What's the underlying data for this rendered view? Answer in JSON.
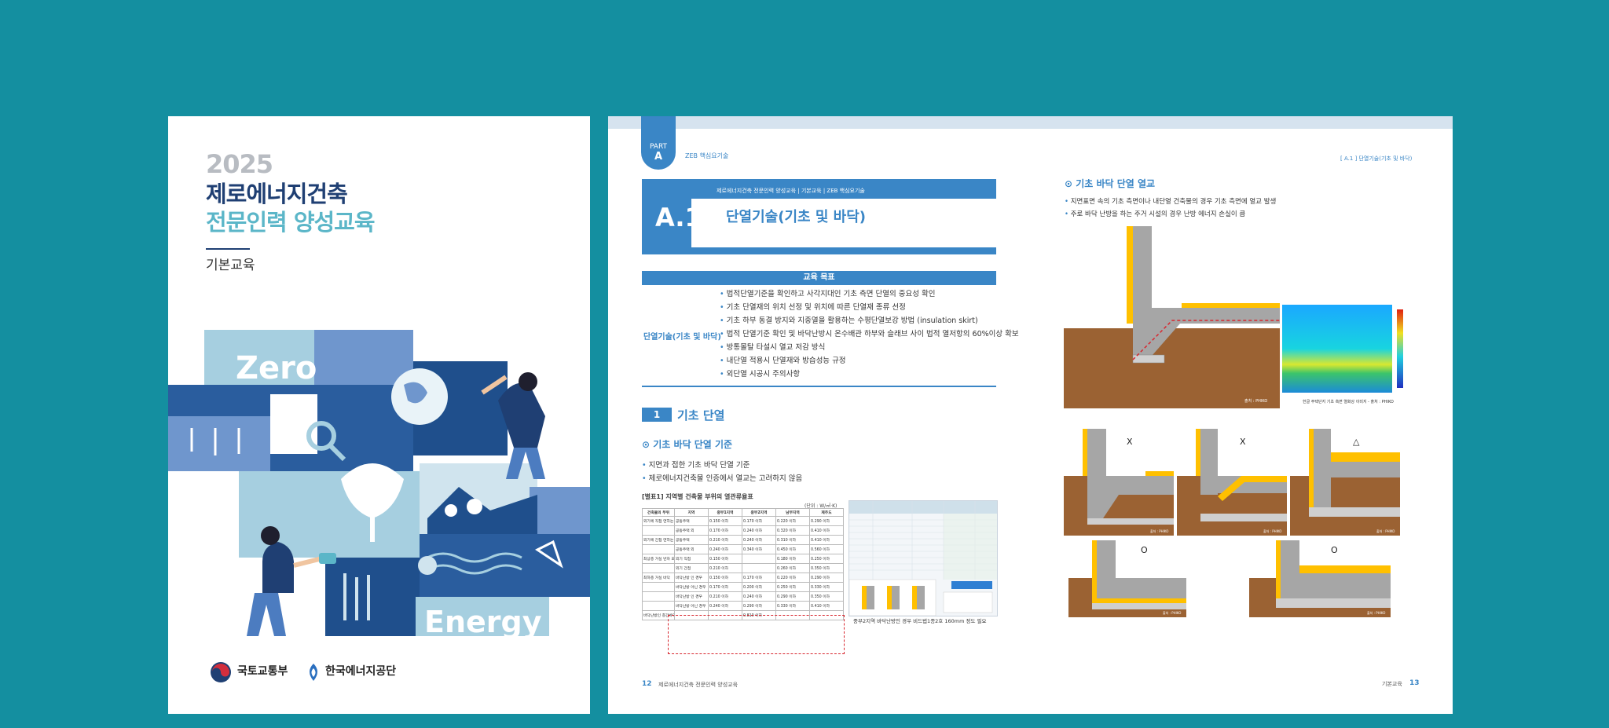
{
  "cover": {
    "year": "2025",
    "title_line1": "제로에너지건축",
    "title_line2": "전문인력 양성교육",
    "subtitle": "기본교육",
    "art_text_zero": "Zero",
    "art_text_energy": "Energy",
    "org1": "국토교통부",
    "org2": "한국에너지공단"
  },
  "left_page": {
    "part_label": "PART",
    "part_letter": "A",
    "part_title": "ZEB 핵심요기술",
    "breadcrumb": "제로에너지건축 전문인력 양성교육 | 기본교육 | ZEB 핵심요기술",
    "chapter_no": "A.1",
    "chapter_title": "단열기술(기초 및 바닥)",
    "goal_header": "교육 목표",
    "goal_label": "단열기술(기초 및 바닥)",
    "goals": [
      "법적단열기준을 확인하고 사각지대인 기초 측면 단열의 중요성 확인",
      "기초 단열재의 위치 선정 및 위치에 따른 단열재 종류 선정",
      "기초 하부 동결 방지와 지중열을 활용하는 수평단열보강 방법 (insulation skirt)",
      "법적 단열기준 확인 및 바닥난방시 온수배관 하부와 슬래브 사이 법적 열저항의 60%이상 확보",
      "방통몰탈 타설시 열교 저감 방식",
      "내단열 적용시 단열재와 방습성능 규정",
      "외단열 시공시 주의사항"
    ],
    "section_no": "1",
    "section_title": "기초 단열",
    "subsection_title": "기초 바닥 단열 기준",
    "bullets": [
      "지면과 접한 기초 바닥 단열 기준",
      "제로에너지건축물 인증에서 열교는 고려하지 않음"
    ],
    "table_caption": "[별표1] 지역별 건축물 부위의 열관류율표",
    "table_unit": "(단위 : W/㎡·K)",
    "table_header": [
      "건축물의 부위",
      "지역",
      "중부1지역",
      "중부2지역",
      "남부지역",
      "제주도"
    ],
    "table_rows": [
      [
        "외기에 직접 면하는 경우",
        "공동주택",
        "0.150 이하",
        "0.170 이하",
        "0.220 이하",
        "0.290 이하"
      ],
      [
        "",
        "공동주택 외",
        "0.170 이하",
        "0.240 이하",
        "0.320 이하",
        "0.410 이하"
      ],
      [
        "외기에 간접 면하는 경우",
        "공동주택",
        "0.210 이하",
        "0.240 이하",
        "0.310 이하",
        "0.410 이하"
      ],
      [
        "",
        "공동주택 외",
        "0.240 이하",
        "0.340 이하",
        "0.450 이하",
        "0.560 이하"
      ],
      [
        "최상층 거실 반자 또는 지붕",
        "외기 직접",
        "0.150 이하",
        "",
        "0.180 이하",
        "0.250 이하"
      ],
      [
        "",
        "외기 간접",
        "0.210 이하",
        "",
        "0.260 이하",
        "0.350 이하"
      ],
      [
        "최하층 거실 바닥",
        "바닥난방 인 경우",
        "0.150 이하",
        "0.170 이하",
        "0.220 이하",
        "0.290 이하"
      ],
      [
        "",
        "바닥난방 아닌 경우",
        "0.170 이하",
        "0.200 이하",
        "0.250 이하",
        "0.330 이하"
      ],
      [
        "",
        "바닥난방 인 경우",
        "0.210 이하",
        "0.240 이하",
        "0.290 이하",
        "0.350 이하"
      ],
      [
        "",
        "바닥난방 아닌 경우",
        "0.240 이하",
        "0.290 이하",
        "0.330 이하",
        "0.410 이하"
      ],
      [
        "바닥난방인 층간바닥",
        "",
        "",
        "0.810 이하",
        "",
        ""
      ]
    ],
    "screenshot_caption": "중부2지역 바닥난방인 경우 비드법1종2호 160mm 정도 필요",
    "footer_page": "12",
    "footer_text": "제로에너지건축 전문인력 양성교육"
  },
  "right_page": {
    "header": "[ A.1 ]  단열기술(기초 및 바닥)",
    "section_title": "기초 바닥 단열 열교",
    "bullets": [
      "지면표면 속의 기초 측면이나 내단열 건축물의 경우 기초 측면에 열교 발생",
      "주로 바닥 난방을 하는 주거 시설의 경우 난방 에너지 손실이 큼"
    ],
    "fig1_caption": "출처 : PHIKO",
    "fig2_caption": "한글 주택단지 기초 측면 열화상 이미지 - 출처 : PHIKO",
    "ratings": [
      "X",
      "X",
      "△",
      "O",
      "O"
    ],
    "small_caption": "출처 : PHIKO",
    "footer_text": "기본교육",
    "footer_page": "13"
  },
  "colors": {
    "background": "#148fa0",
    "accent_blue": "#3a86c6",
    "navy": "#1f3f73",
    "teal": "#5bb6c8",
    "insulation_yellow": "#ffc000",
    "soil_brown": "#9b6233",
    "concrete_grey": "#a6a6a6"
  }
}
